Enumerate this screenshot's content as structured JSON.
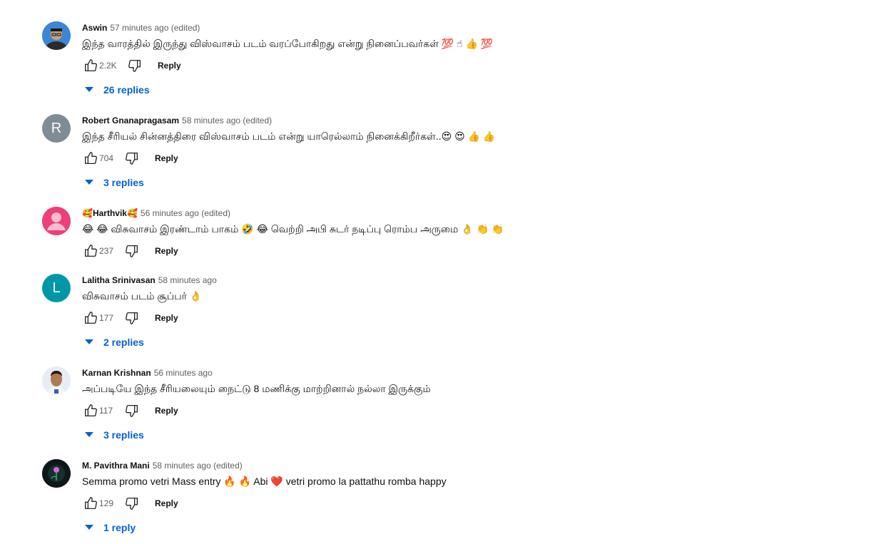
{
  "comments": [
    {
      "author": "Aswin",
      "time": "57 minutes ago (edited)",
      "text": "இந்த வாரத்தில் இருந்து விஸ்வாசம் படம் வரப்போகிறது என்று நினைப்பவர்கள் 💯 ☝ 👍 💯",
      "likes": "2.2K",
      "reply_label": "Reply",
      "replies_label": "26 replies",
      "avatar_type": "photo"
    },
    {
      "author": "Robert Gnanapragasam",
      "time": "58 minutes ago (edited)",
      "text": "இந்த சீரியல் சின்னத்திரை விஸ்வாசம் படம் என்று யாரெல்லாம் நினைக்கிறீர்கள்..😍 😍 👍 👍",
      "likes": "704",
      "reply_label": "Reply",
      "replies_label": "3 replies",
      "avatar_letter": "R",
      "avatar_color": "#7f8c96"
    },
    {
      "author": "🥰Harthvik🥰",
      "time": "56 minutes ago (edited)",
      "text": "😂 😂 விசுவாசம் இரண்டாம் பாகம் 🤣 😂 வெற்றி அபி சுடர் நடிப்பு ரொம்ப அருமை 👌 👏 👏",
      "likes": "237",
      "reply_label": "Reply",
      "replies_label": "",
      "avatar_color": "#ec407a"
    },
    {
      "author": "Lalitha Srinivasan",
      "time": "58 minutes ago",
      "text": "விசுவாசம் படம் சூப்பர் 👌",
      "likes": "177",
      "reply_label": "Reply",
      "replies_label": "2 replies",
      "avatar_letter": "L",
      "avatar_color": "#0097a7"
    },
    {
      "author": "Karnan Krishnan",
      "time": "56 minutes ago",
      "text": "அப்படியே இந்த சீரியலையும் நைட்டு 8 மணிக்கு மாற்றினால் நல்லா இருக்கும்",
      "likes": "117",
      "reply_label": "Reply",
      "replies_label": "3 replies",
      "avatar_type": "photo"
    },
    {
      "author": "M. Pavithra Mani",
      "time": "58 minutes ago (edited)",
      "text": "Semma promo vetri Mass entry 🔥 🔥 Abi ❤️ vetri promo la pattathu romba happy",
      "likes": "129",
      "reply_label": "Reply",
      "replies_label": "1 reply",
      "avatar_type": "photo"
    }
  ],
  "colors": {
    "link": "#065fd4",
    "meta": "#606060",
    "text": "#0f0f0f"
  }
}
